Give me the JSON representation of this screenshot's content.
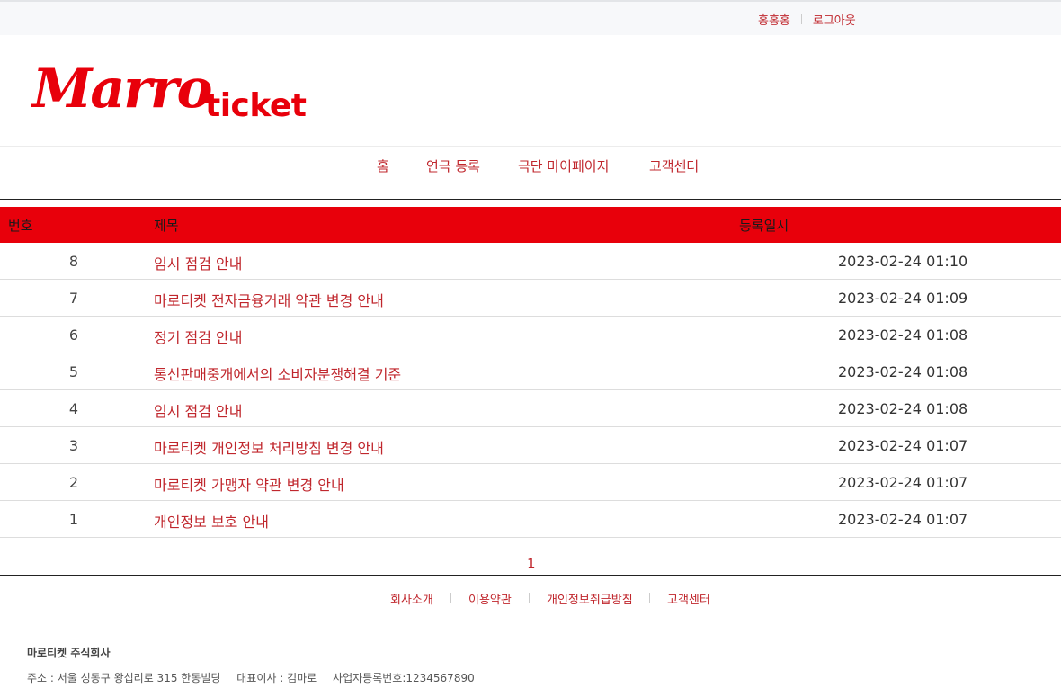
{
  "topbar": {
    "user_name": "홍홍홍",
    "logout_label": "로그아웃"
  },
  "logo": {
    "script": "Marro",
    "word": "ticket"
  },
  "nav": {
    "items": [
      {
        "label": "홈"
      },
      {
        "label": "연극 등록"
      },
      {
        "label": "극단 마이페이지"
      },
      {
        "label": "고객센터"
      }
    ]
  },
  "table": {
    "headers": {
      "num": "번호",
      "title": "제목",
      "date": "등록일시"
    },
    "rows": [
      {
        "num": "8",
        "title": "임시 점검 안내",
        "date": "2023-02-24 01:10"
      },
      {
        "num": "7",
        "title": "마로티켓 전자금융거래 약관 변경 안내",
        "date": "2023-02-24 01:09"
      },
      {
        "num": "6",
        "title": "정기 점검 안내",
        "date": "2023-02-24 01:08"
      },
      {
        "num": "5",
        "title": "통신판매중개에서의 소비자분쟁해결 기준",
        "date": "2023-02-24 01:08"
      },
      {
        "num": "4",
        "title": "임시 점검 안내",
        "date": "2023-02-24 01:08"
      },
      {
        "num": "3",
        "title": "마로티켓 개인정보 처리방침 변경 안내",
        "date": "2023-02-24 01:07"
      },
      {
        "num": "2",
        "title": "마로티켓 가맹자 약관 변경 안내",
        "date": "2023-02-24 01:07"
      },
      {
        "num": "1",
        "title": "개인정보 보호 안내",
        "date": "2023-02-24 01:07"
      }
    ]
  },
  "pagination": {
    "current": "1"
  },
  "footer": {
    "links": [
      {
        "label": "회사소개"
      },
      {
        "label": "이용약관"
      },
      {
        "label": "개인정보취급방침"
      },
      {
        "label": "고객센터"
      }
    ],
    "company_name": "마로티켓 주식회사",
    "address": "주소 : 서울 성동구 왕십리로 315 한동빌딩",
    "ceo": "대표이사 : 김마로",
    "business_number": "사업자등록번호:1234567890"
  },
  "colors": {
    "brand_red": "#e8000b",
    "link_red": "#c0272d"
  }
}
